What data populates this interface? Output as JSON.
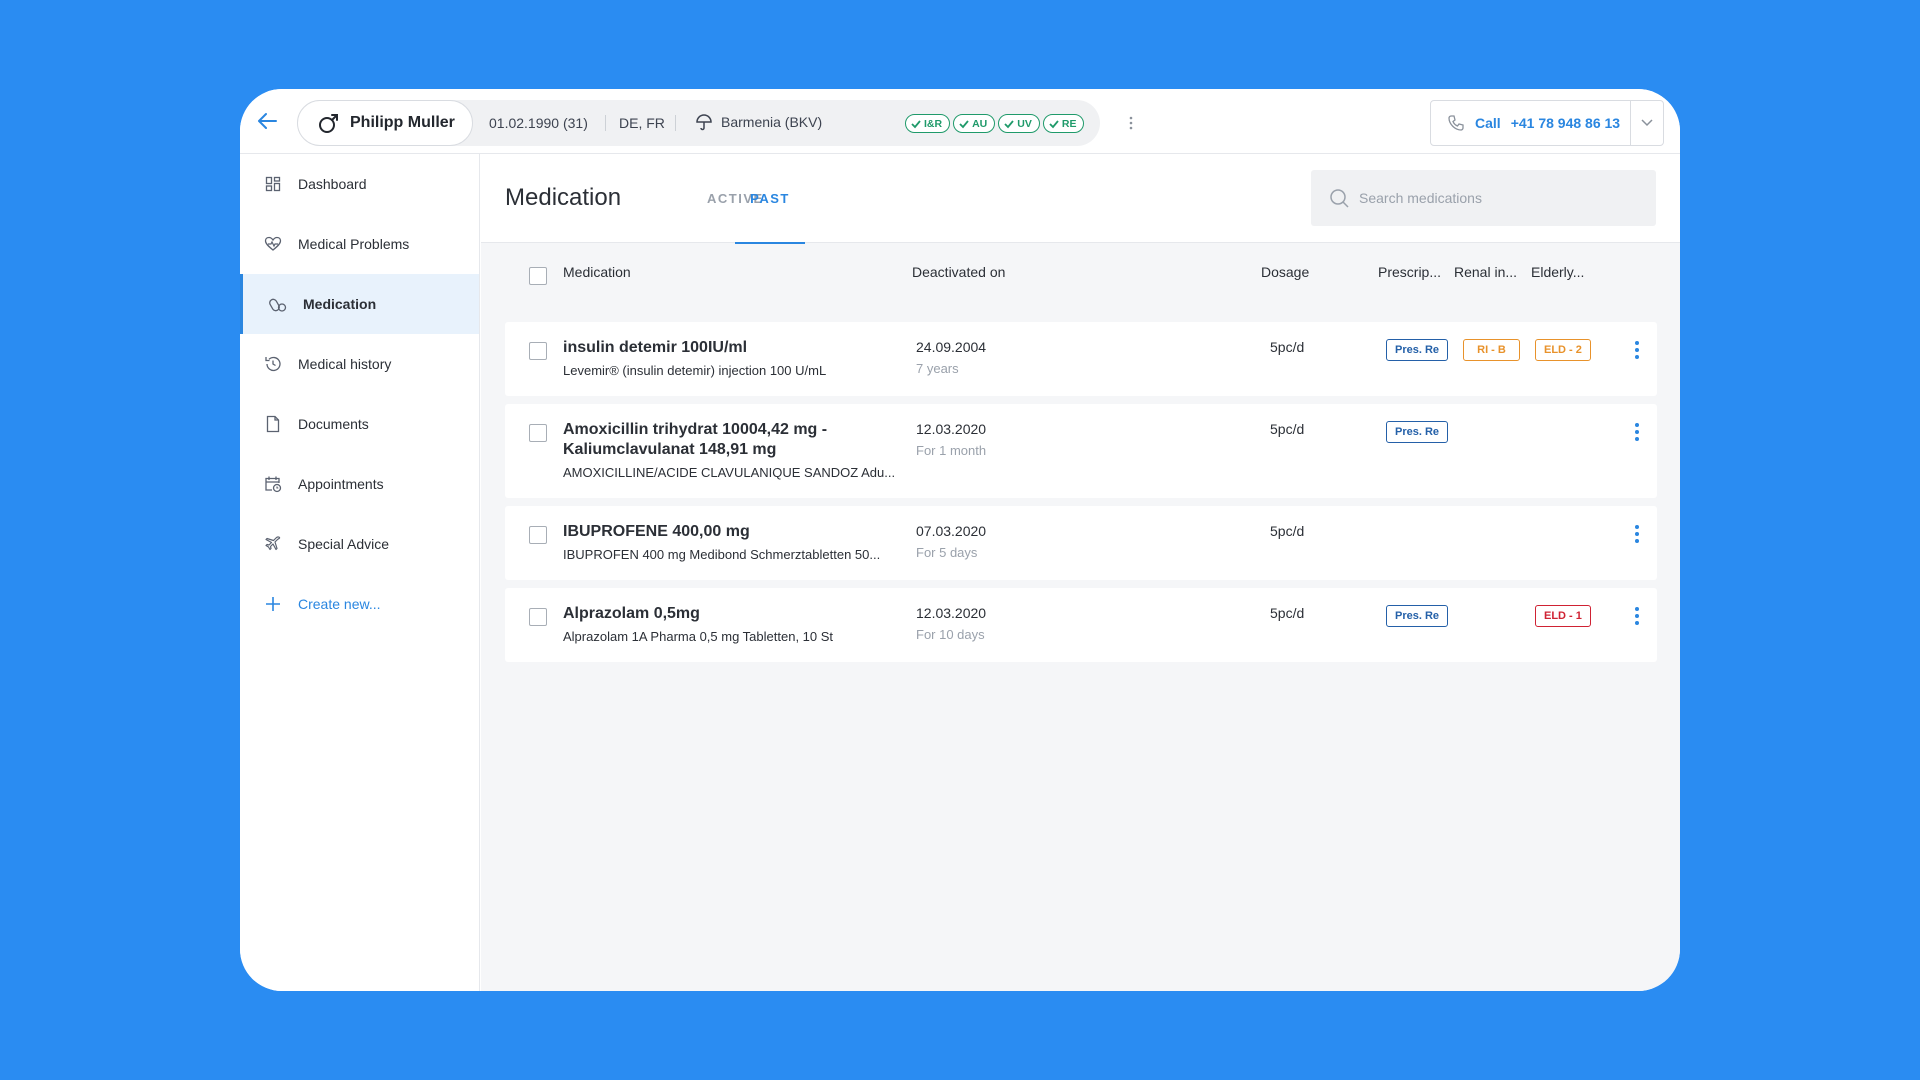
{
  "patient": {
    "name": "Philipp Muller",
    "dob": "01.02.1990 (31)",
    "languages": "DE, FR",
    "insurance": "Barmenia (BKV)",
    "badges": [
      "I&R",
      "AU",
      "UV",
      "RE"
    ]
  },
  "call": {
    "label": "Call",
    "number": "+41 78 948 86 13"
  },
  "sidebar": {
    "items": [
      {
        "label": "Dashboard",
        "icon": "dashboard-icon"
      },
      {
        "label": "Medical Problems",
        "icon": "heart-pulse-icon"
      },
      {
        "label": "Medication",
        "icon": "pills-icon",
        "active": true
      },
      {
        "label": "Medical history",
        "icon": "history-clock-icon"
      },
      {
        "label": "Documents",
        "icon": "document-icon"
      },
      {
        "label": "Appointments",
        "icon": "calendar-clock-icon"
      },
      {
        "label": "Special Advice",
        "icon": "plane-icon"
      }
    ],
    "create_label": "Create new..."
  },
  "main": {
    "title": "Medication",
    "tabs": [
      {
        "label": "ACTIVE",
        "active": false
      },
      {
        "label": "PAST",
        "active": true
      }
    ],
    "search_placeholder": "Search medications",
    "columns": {
      "medication": "Medication",
      "deactivated": "Deactivated on",
      "dosage": "Dosage",
      "prescription": "Prescrip...",
      "renal": "Renal in...",
      "elderly": "Elderly..."
    },
    "rows": [
      {
        "name": "insulin detemir 100IU/ml",
        "sub": "Levemir® (insulin detemir) injection 100 U/mL",
        "date": "24.09.2004",
        "duration": "7 years",
        "dosage": "5pc/d",
        "prescription": "Pres. Re",
        "renal": "RI - B",
        "elderly": "ELD - 2"
      },
      {
        "name": "Amoxicillin trihydrat 10004,42 mg - Kaliumclavulanat 148,91 mg",
        "sub": "AMOXICILLINE/ACIDE CLAVULANIQUE SANDOZ Adu...",
        "date": "12.03.2020",
        "duration": "For 1 month",
        "dosage": "5pc/d",
        "prescription": "Pres. Re"
      },
      {
        "name": "IBUPROFENE 400,00 mg",
        "sub": "IBUPROFEN 400 mg Medibond Schmerztabletten 50...",
        "date": "07.03.2020",
        "duration": "For 5 days",
        "dosage": "5pc/d"
      },
      {
        "name": "Alprazolam 0,5mg",
        "sub": "Alprazolam 1A Pharma 0,5 mg Tabletten, 10 St",
        "date": "12.03.2020",
        "duration": "For 10 days",
        "dosage": "5pc/d",
        "prescription": "Pres. Re",
        "elderly": "ELD - 1"
      }
    ]
  },
  "colors": {
    "background": "#2a8cf2",
    "accent": "#2a86e0",
    "tag_blue": "#2460a8",
    "tag_orange": "#e8922b",
    "tag_red": "#cf2233",
    "badge_green": "#1f9a6a"
  }
}
